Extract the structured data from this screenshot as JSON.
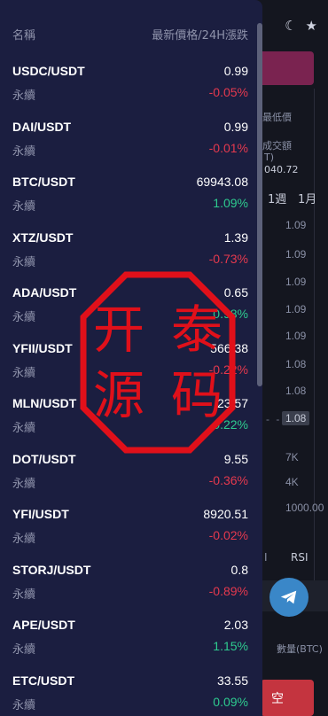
{
  "background": {
    "header_icons": [
      "moon-icon",
      "star-icon"
    ],
    "labels": [
      "最低價",
      "成交額",
      "T)",
      "040.72",
      "1週",
      "1月"
    ],
    "column_values": [
      "1.09",
      "1.09",
      "1.09",
      "1.09",
      "1.09",
      "1.08",
      "1.08",
      "1.08"
    ],
    "dashes": "- - -",
    "highlight_value": "1.08",
    "depth_labels": [
      "7K",
      "4K",
      "1000.00"
    ],
    "rsi": "RSI",
    "amount_label": "數量(BTC)",
    "sell_button": "空"
  },
  "drawer": {
    "header": {
      "name": "名稱",
      "price_change": "最新價格/24H漲跌"
    },
    "rows": [
      {
        "symbol": "USDC/USDT",
        "type": "永續",
        "price": "0.99",
        "change": "-0.05%",
        "dir": "down"
      },
      {
        "symbol": "DAI/USDT",
        "type": "永續",
        "price": "0.99",
        "change": "-0.01%",
        "dir": "down"
      },
      {
        "symbol": "BTC/USDT",
        "type": "永續",
        "price": "69943.08",
        "change": "1.09%",
        "dir": "up"
      },
      {
        "symbol": "XTZ/USDT",
        "type": "永續",
        "price": "1.39",
        "change": "-0.73%",
        "dir": "down"
      },
      {
        "symbol": "ADA/USDT",
        "type": "永續",
        "price": "0.65",
        "change": "0.98%",
        "dir": "up"
      },
      {
        "symbol": "YFII/USDT",
        "type": "永續",
        "price": "566.38",
        "change": "-0.22%",
        "dir": "down"
      },
      {
        "symbol": "MLN/USDT",
        "type": "永續",
        "price": "23.57",
        "change": "0.22%",
        "dir": "up"
      },
      {
        "symbol": "DOT/USDT",
        "type": "永續",
        "price": "9.55",
        "change": "-0.36%",
        "dir": "down"
      },
      {
        "symbol": "YFI/USDT",
        "type": "永續",
        "price": "8920.51",
        "change": "-0.02%",
        "dir": "down"
      },
      {
        "symbol": "STORJ/USDT",
        "type": "永續",
        "price": "0.8",
        "change": "-0.89%",
        "dir": "down"
      },
      {
        "symbol": "APE/USDT",
        "type": "永續",
        "price": "2.03",
        "change": "1.15%",
        "dir": "up"
      },
      {
        "symbol": "ETC/USDT",
        "type": "永續",
        "price": "33.55",
        "change": "0.09%",
        "dir": "up"
      }
    ]
  },
  "watermark": {
    "text": "开泰源码"
  },
  "colors": {
    "drawer_bg": "#1b1e40",
    "up": "#2ecb8f",
    "down": "#e5394e",
    "stamp": "#e0101a"
  }
}
